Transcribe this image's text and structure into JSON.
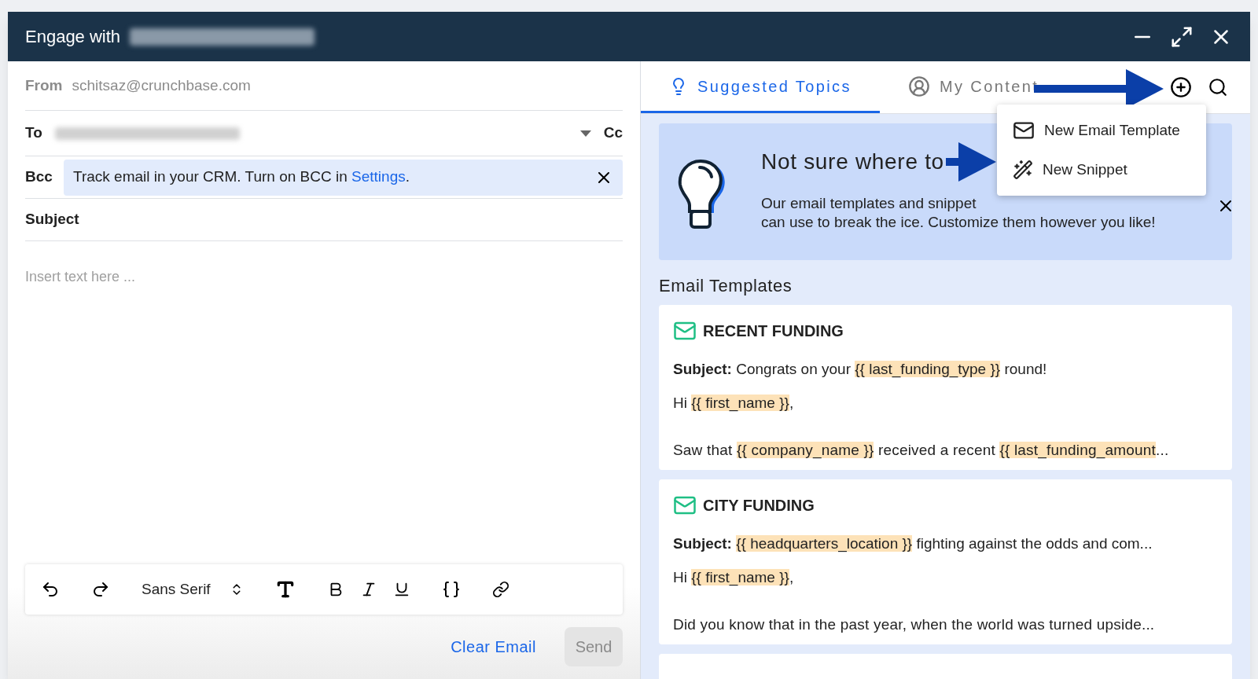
{
  "window": {
    "title": "Engage with"
  },
  "compose": {
    "from_label": "From",
    "from_value": "schitsaz@crunchbase.com",
    "to_label": "To",
    "cc_label": "Cc",
    "bcc_label": "Bcc",
    "bcc_notice": "Track email in your CRM. Turn on BCC in ",
    "bcc_link": "Settings",
    "bcc_after": ".",
    "subject_label": "Subject",
    "body_placeholder": "Insert text here ...",
    "font": "Sans Serif",
    "clear_button": "Clear Email",
    "send_button": "Send",
    "send_disabled": true
  },
  "tabs": [
    {
      "label": "Suggested Topics",
      "selected": true,
      "kind": "bulb"
    },
    {
      "label": "My Content",
      "selected": false,
      "kind": "user"
    }
  ],
  "add_menu": {
    "items": [
      {
        "label": "New Email Template",
        "kind": "email"
      },
      {
        "label": "New Snippet",
        "kind": "snippet"
      }
    ]
  },
  "banner": {
    "heading": "Not sure where to",
    "lines": [
      "Our email templates and snippet",
      "can use to break the ice. Customize them however you like!"
    ]
  },
  "templates": {
    "heading": "Email Templates",
    "cards": [
      {
        "title": "RECENT FUNDING",
        "subject_label": "Subject:",
        "subject": [
          {
            "kind": "text",
            "text": "Congrats on your "
          },
          {
            "kind": "var",
            "text": "{{ last_funding_type }}"
          },
          {
            "kind": "text",
            "text": " round!"
          }
        ],
        "greeting": [
          {
            "kind": "text",
            "text": "Hi "
          },
          {
            "kind": "var",
            "text": "{{ first_name }}"
          },
          {
            "kind": "text",
            "text": ","
          }
        ],
        "preview": [
          {
            "kind": "text",
            "text": "Saw that "
          },
          {
            "kind": "var",
            "text": "{{ company_name }}"
          },
          {
            "kind": "text",
            "text": " received a recent "
          },
          {
            "kind": "var",
            "text": "{{ last_funding_amount"
          },
          {
            "kind": "text",
            "text": "..."
          }
        ]
      },
      {
        "title": "CITY FUNDING",
        "subject_label": "Subject:",
        "subject": [
          {
            "kind": "var",
            "text": "{{ headquarters_location }}"
          },
          {
            "kind": "text",
            "text": " fighting against the odds and com..."
          }
        ],
        "greeting": [
          {
            "kind": "text",
            "text": "Hi "
          },
          {
            "kind": "var",
            "text": "{{ first_name }}"
          },
          {
            "kind": "text",
            "text": ","
          }
        ],
        "preview": [
          {
            "kind": "text",
            "text": "Did you know that in the past year, when the world was turned upside..."
          }
        ]
      }
    ]
  }
}
